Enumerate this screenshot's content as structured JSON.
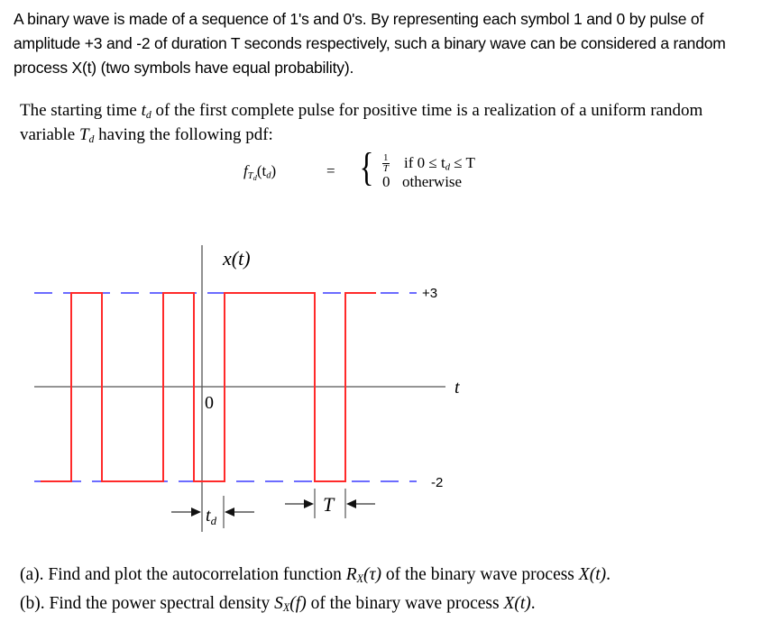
{
  "intro_text": "A binary wave is made of a sequence of 1's and 0's. By representing each symbol 1 and 0 by pulse of amplitude +3 and -2 of duration T seconds respectively, such a binary wave can be considered a random process X(t) (two symbols have equal probability).",
  "paragraph2": {
    "part1": "The starting time ",
    "td": "t",
    "td_sub": "d",
    "part2": " of the first complete pulse for positive time is a realization of a uniform random variable ",
    "Td": "T",
    "Td_sub": "d",
    "part3": " having the following pdf:"
  },
  "equation": {
    "lhs_f": "f",
    "lhs_sub_T": "T",
    "lhs_sub_d": "d",
    "lhs_arg": "(t",
    "lhs_arg_sub": "d",
    "lhs_close": ")",
    "equals": "=",
    "brace": "{",
    "case1_num": "1",
    "case1_den": "T",
    "case1_cond": "if  0 ≤ t",
    "case1_cond_sub": "d",
    "case1_cond_end": " ≤ T",
    "case2_value": "0",
    "case2_cond": "otherwise"
  },
  "figure": {
    "y_axis_label": "x(t)",
    "x_axis_label": "t",
    "origin_label": "0",
    "level_high_label": "+3",
    "level_low_label": "-2",
    "td_label": "t",
    "td_label_sub": "d",
    "T_label": "T",
    "levels": {
      "high": 3,
      "low": -2
    },
    "pulse_sequence_values": [
      -2,
      3,
      -2,
      -2,
      3,
      -2,
      3,
      3,
      3,
      -2,
      3
    ],
    "colors": {
      "waveform": "#ff2a2a",
      "level_lines": "#3b3bff",
      "axes": "#555555"
    }
  },
  "questions": [
    {
      "prefix": "(a). Find and plot the autocorrelation function ",
      "fn": "R",
      "fn_sub": "X",
      "arg": "(τ)",
      "mid": " of the binary wave process ",
      "proc": "X",
      "proc_arg": "(t)",
      "end": "."
    },
    {
      "prefix": "(b). Find the power spectral density ",
      "fn": "S",
      "fn_sub": "X",
      "arg": "(f)",
      "mid": " of the binary wave process ",
      "proc": "X",
      "proc_arg": "(t)",
      "end": "."
    }
  ]
}
